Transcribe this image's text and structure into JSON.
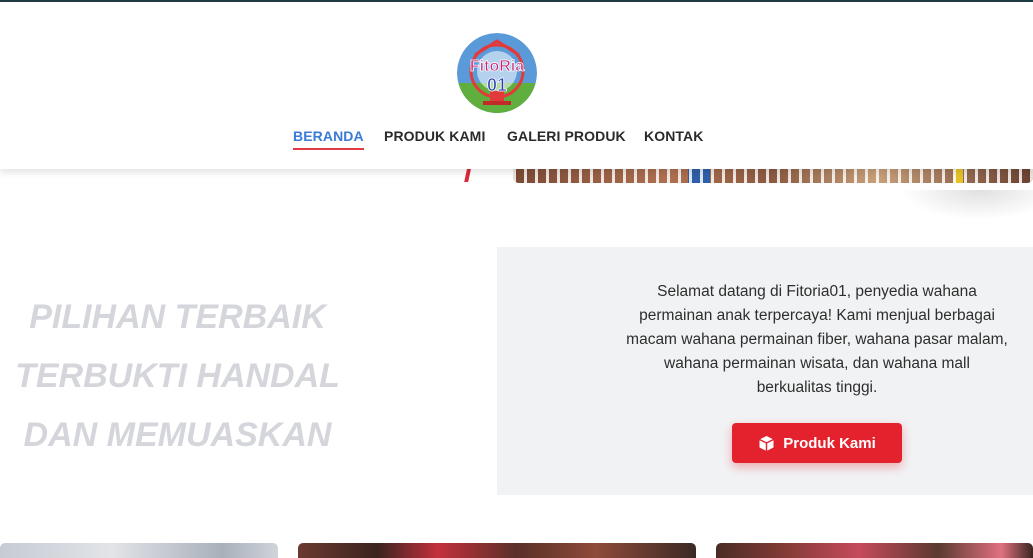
{
  "brand": {
    "logo_text": "FitoRia01"
  },
  "nav": {
    "items": [
      {
        "label": "BERANDA",
        "active": true
      },
      {
        "label": "PRODUK KAMI",
        "active": false
      },
      {
        "label": "GALERI PRODUK",
        "active": false
      },
      {
        "label": "KONTAK",
        "active": false
      }
    ]
  },
  "hero": {
    "tagline": [
      "PILIHAN TERBAIK",
      "TERBUKTI HANDAL",
      "DAN MEMUASKAN"
    ]
  },
  "welcome": {
    "text": "Selamat datang di Fitoria01, penyedia wahana permainan anak terpercaya! Kami menjual berbagai macam wahana permainan fiber, wahana pasar malam, wahana permainan wisata, dan wahana mall berkualitas tinggi.",
    "button_label": "Produk Kami",
    "button_icon": "box-icon"
  },
  "colors": {
    "accent_blue": "#3a7bd5",
    "accent_red": "#e3222e",
    "tagline_gray": "#d4d6dc",
    "panel_bg": "#f1f2f4"
  }
}
